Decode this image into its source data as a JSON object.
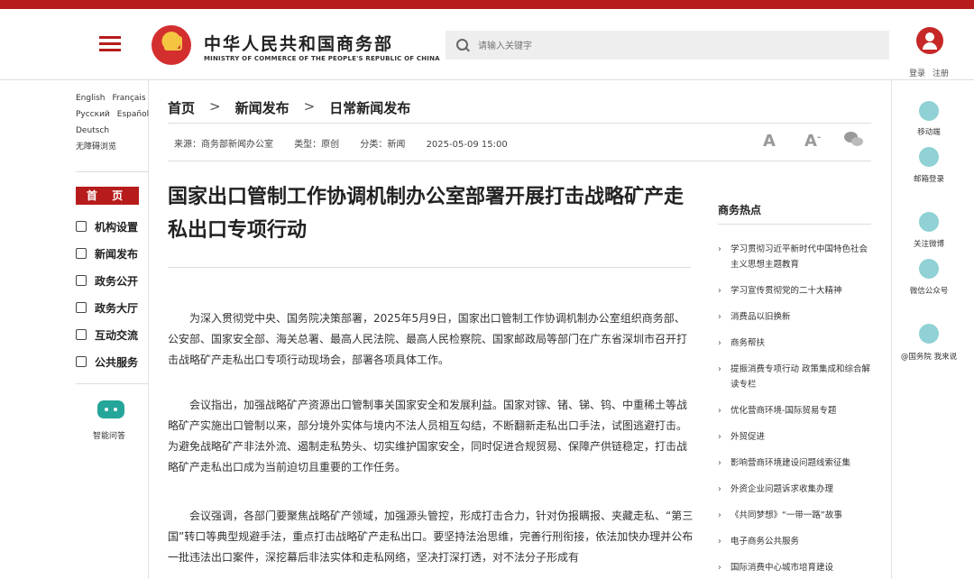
{
  "header": {
    "title_cn": "中华人民共和国商务部",
    "title_en": "MINISTRY OF COMMERCE OF THE PEOPLE'S REPUBLIC OF CHINA",
    "search_placeholder": "请输入关键字",
    "login": "登录",
    "register": "注册",
    "accent_color": "#b71c1c"
  },
  "left_nav": {
    "langs": [
      "English",
      "Français",
      "Русский",
      "Español",
      "Deutsch",
      "无障碍浏览"
    ],
    "home": "首 页",
    "items": [
      "机构设置",
      "新闻发布",
      "政务公开",
      "政务大厅",
      "互动交流",
      "公共服务"
    ],
    "assistant": "智能问答"
  },
  "breadcrumb": [
    "首页",
    "新闻发布",
    "日常新闻发布"
  ],
  "meta": {
    "source": "来源：商务部新闻办公室",
    "type": "类型：原创",
    "category": "分类：新闻",
    "date": "2025-05-09 15:00",
    "font_large": "A",
    "font_small": "A"
  },
  "article": {
    "title": "国家出口管制工作协调机制办公室部署开展打击战略矿产走私出口专项行动",
    "paragraphs": [
      "为深入贯彻党中央、国务院决策部署，2025年5月9日，国家出口管制工作协调机制办公室组织商务部、公安部、国家安全部、海关总署、最高人民法院、最高人民检察院、国家邮政局等部门在广东省深圳市召开打击战略矿产走私出口专项行动现场会，部署各项具体工作。",
      "会议指出，加强战略矿产资源出口管制事关国家安全和发展利益。国家对镓、锗、锑、钨、中重稀土等战略矿产实施出口管制以来，部分境外实体与境内不法人员相互勾结，不断翻新走私出口手法，试图逃避打击。为避免战略矿产非法外流、遏制走私势头、切实维护国家安全，同时促进合规贸易、保障产供链稳定，打击战略矿产走私出口成为当前迫切且重要的工作任务。",
      "会议强调，各部门要聚焦战略矿产领域，加强源头管控，形成打击合力，针对伪报瞒报、夹藏走私、“第三国”转口等典型规避手法，重点打击战略矿产走私出口。要坚持法治思维，完善行刑衔接，依法加快办理并公布一批违法出口案件，深挖幕后非法实体和走私网络，坚决打深打透，对不法分子形成有"
    ]
  },
  "hot": {
    "title": "商务热点",
    "items": [
      "学习贯彻习近平新时代中国特色社会主义思想主题教育",
      "学习宣传贯彻党的二十大精神",
      "消费品以旧换新",
      "商务帮扶",
      "提振消费专项行动 政策集成和综合解读专栏",
      "优化营商环境-国际贸易专题",
      "外贸促进",
      "影响营商环境建设问题线索征集",
      "外资企业问题诉求收集办理",
      "《共同梦想》“一带一路”故事",
      "电子商务公共服务",
      "国际消费中心城市培育建设"
    ]
  },
  "right_bar": [
    "移动端",
    "邮箱登录",
    "关注微博",
    "微信公众号",
    "@国务院 我来说"
  ]
}
